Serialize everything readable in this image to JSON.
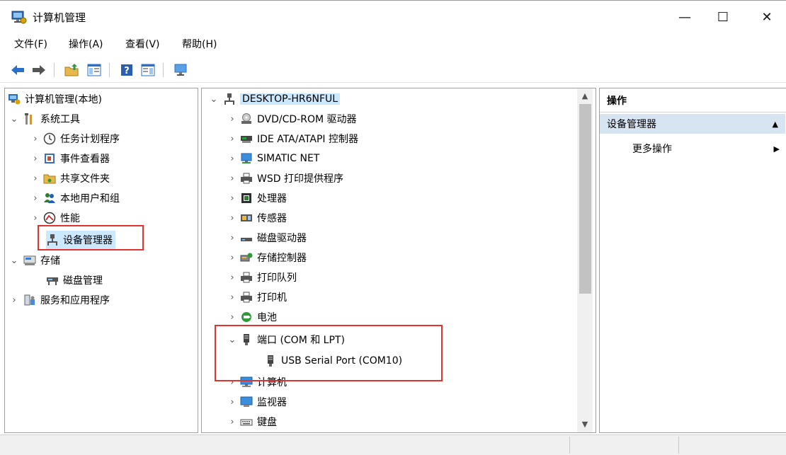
{
  "window": {
    "title": "计算机管理",
    "controls": {
      "minimize": "—",
      "maximize": "☐",
      "close": "✕"
    }
  },
  "menu": [
    "文件(F)",
    "操作(A)",
    "查看(V)",
    "帮助(H)"
  ],
  "toolbar_icons": [
    "back-icon",
    "forward-icon",
    "up-folder-icon",
    "show-hide-tree-icon",
    "help-icon",
    "action-pane-icon",
    "monitor-icon"
  ],
  "left_tree": {
    "root": "计算机管理(本地)",
    "system_tools": "系统工具",
    "items": [
      "任务计划程序",
      "事件查看器",
      "共享文件夹",
      "本地用户和组",
      "性能",
      "设备管理器"
    ],
    "storage": "存储",
    "disk_management": "磁盘管理",
    "services": "服务和应用程序"
  },
  "device_tree": {
    "computer": "DESKTOP-HR6NFUL",
    "categories": [
      "DVD/CD-ROM 驱动器",
      "IDE ATA/ATAPI 控制器",
      "SIMATIC NET",
      "WSD 打印提供程序",
      "处理器",
      "传感器",
      "磁盘驱动器",
      "存储控制器",
      "打印队列",
      "打印机",
      "电池",
      "端口 (COM 和 LPT)",
      "计算机",
      "监视器",
      "键盘"
    ],
    "port_child": "USB Serial Port (COM10)"
  },
  "actions": {
    "header": "操作",
    "section": "设备管理器",
    "more": "更多操作"
  },
  "colors": {
    "highlight_box": "#e0332f",
    "selected_bg": "#cce8ff",
    "section_bg": "#d7e4f2"
  }
}
